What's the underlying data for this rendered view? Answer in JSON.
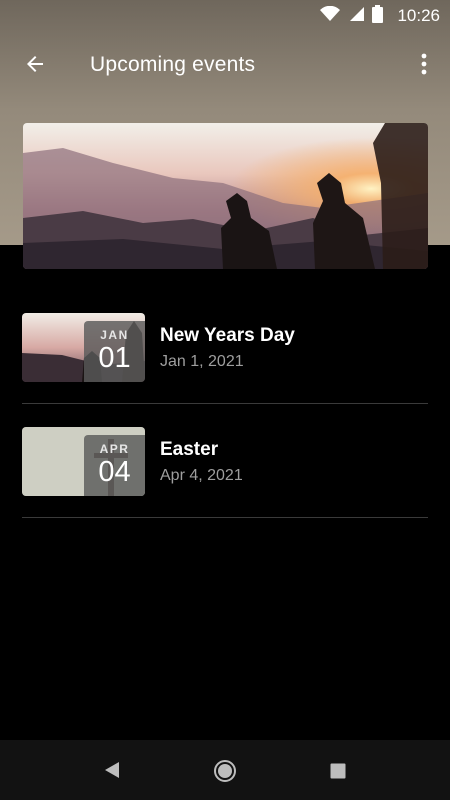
{
  "status_bar": {
    "time": "10:26"
  },
  "app_bar": {
    "title": "Upcoming events"
  },
  "events": [
    {
      "month": "JAN",
      "day": "01",
      "title": "New Years Day",
      "date": "Jan 1, 2021"
    },
    {
      "month": "APR",
      "day": "04",
      "title": "Easter",
      "date": "Apr 4, 2021"
    }
  ],
  "colors": {
    "background": "#000000",
    "header_band": "#948a7b",
    "secondary_text": "#9e9e9e",
    "divider": "#3a3a3a"
  },
  "icons": [
    "wifi-icon",
    "cell-signal-icon",
    "battery-icon",
    "back-arrow-icon",
    "more-vertical-icon",
    "nav-back-icon",
    "nav-home-icon",
    "nav-recents-icon"
  ]
}
